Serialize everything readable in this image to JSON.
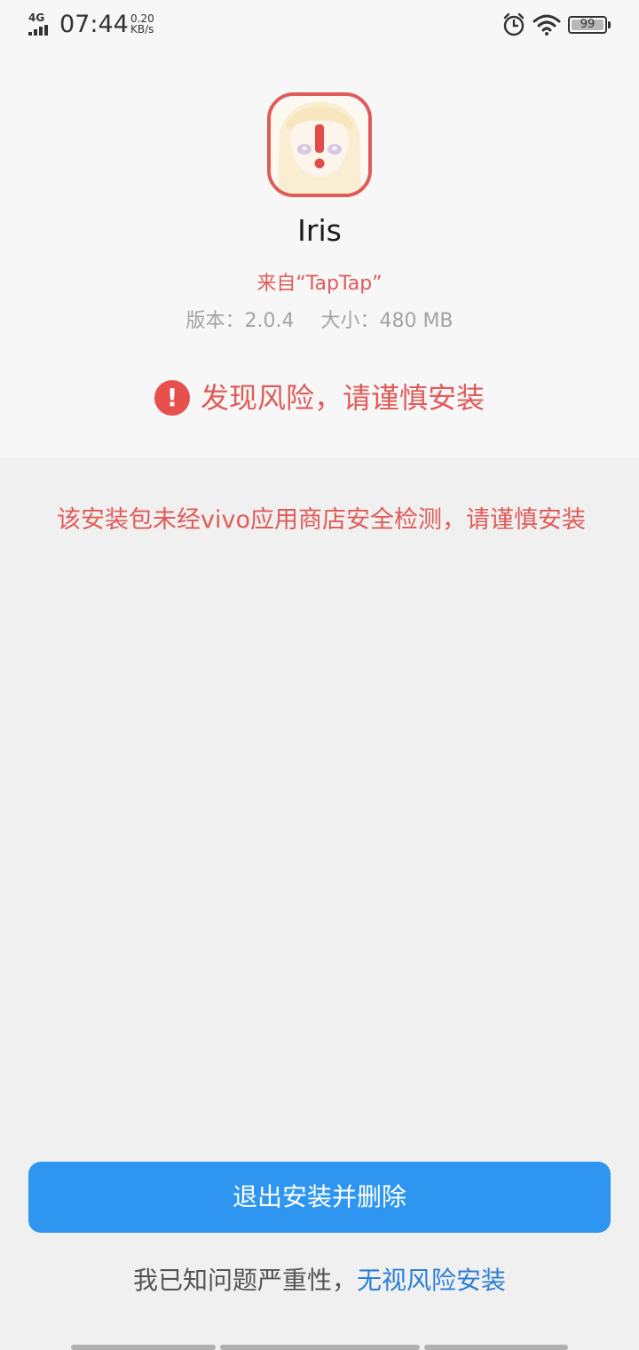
{
  "status_bar": {
    "network_type": "4G",
    "time": "07:44",
    "speed_value": "0.20",
    "speed_unit": "KB/s",
    "battery_level": "99",
    "icons": [
      "signal-icon",
      "alarm-icon",
      "wifi-icon",
      "battery-icon"
    ]
  },
  "app": {
    "name": "Iris",
    "source": "来自“TapTap”",
    "version_label": "版本：2.0.4",
    "size_label": "大小：480 MB"
  },
  "risk": {
    "headline": "发现风险，请谨慎安装",
    "icon_glyph": "!",
    "message": "该安装包未经vivo应用商店安全检测，请谨慎安装"
  },
  "actions": {
    "primary_label": "退出安装并删除",
    "ack_prefix": "我已知问题严重性，",
    "ack_link": "无视风险安装"
  },
  "colors": {
    "accent_blue": "#2e96f0",
    "link_blue": "#2c7fd6",
    "danger_red": "#e05b58"
  }
}
